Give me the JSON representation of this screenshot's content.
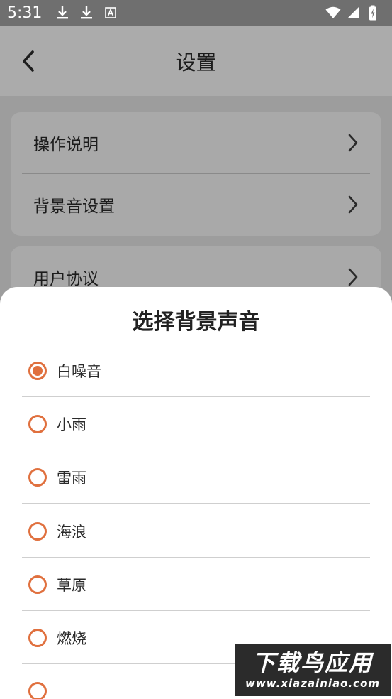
{
  "status_bar": {
    "time": "5:31",
    "left_icons": [
      "download-icon",
      "download-icon",
      "text-a-icon"
    ],
    "right_icons": [
      "wifi-icon",
      "signal-icon",
      "battery-charging-icon"
    ]
  },
  "toolbar": {
    "back_icon": "chevron-left-icon",
    "title": "设置"
  },
  "settings": {
    "items": [
      {
        "label": "操作说明"
      },
      {
        "label": "背景音设置"
      },
      {
        "label": "用户协议"
      }
    ]
  },
  "sheet": {
    "title": "选择背景声音",
    "selected_index": 0,
    "options": [
      {
        "label": "白噪音"
      },
      {
        "label": "小雨"
      },
      {
        "label": "雷雨"
      },
      {
        "label": "海浪"
      },
      {
        "label": "草原"
      },
      {
        "label": "燃烧"
      }
    ]
  },
  "watermark": {
    "main": "下载鸟应用",
    "sub": "www.xiazainiao.com"
  },
  "colors": {
    "accent": "#e0703e",
    "status_bar": "#6f6f6f",
    "overlay_bg": "#9d9d9d"
  }
}
